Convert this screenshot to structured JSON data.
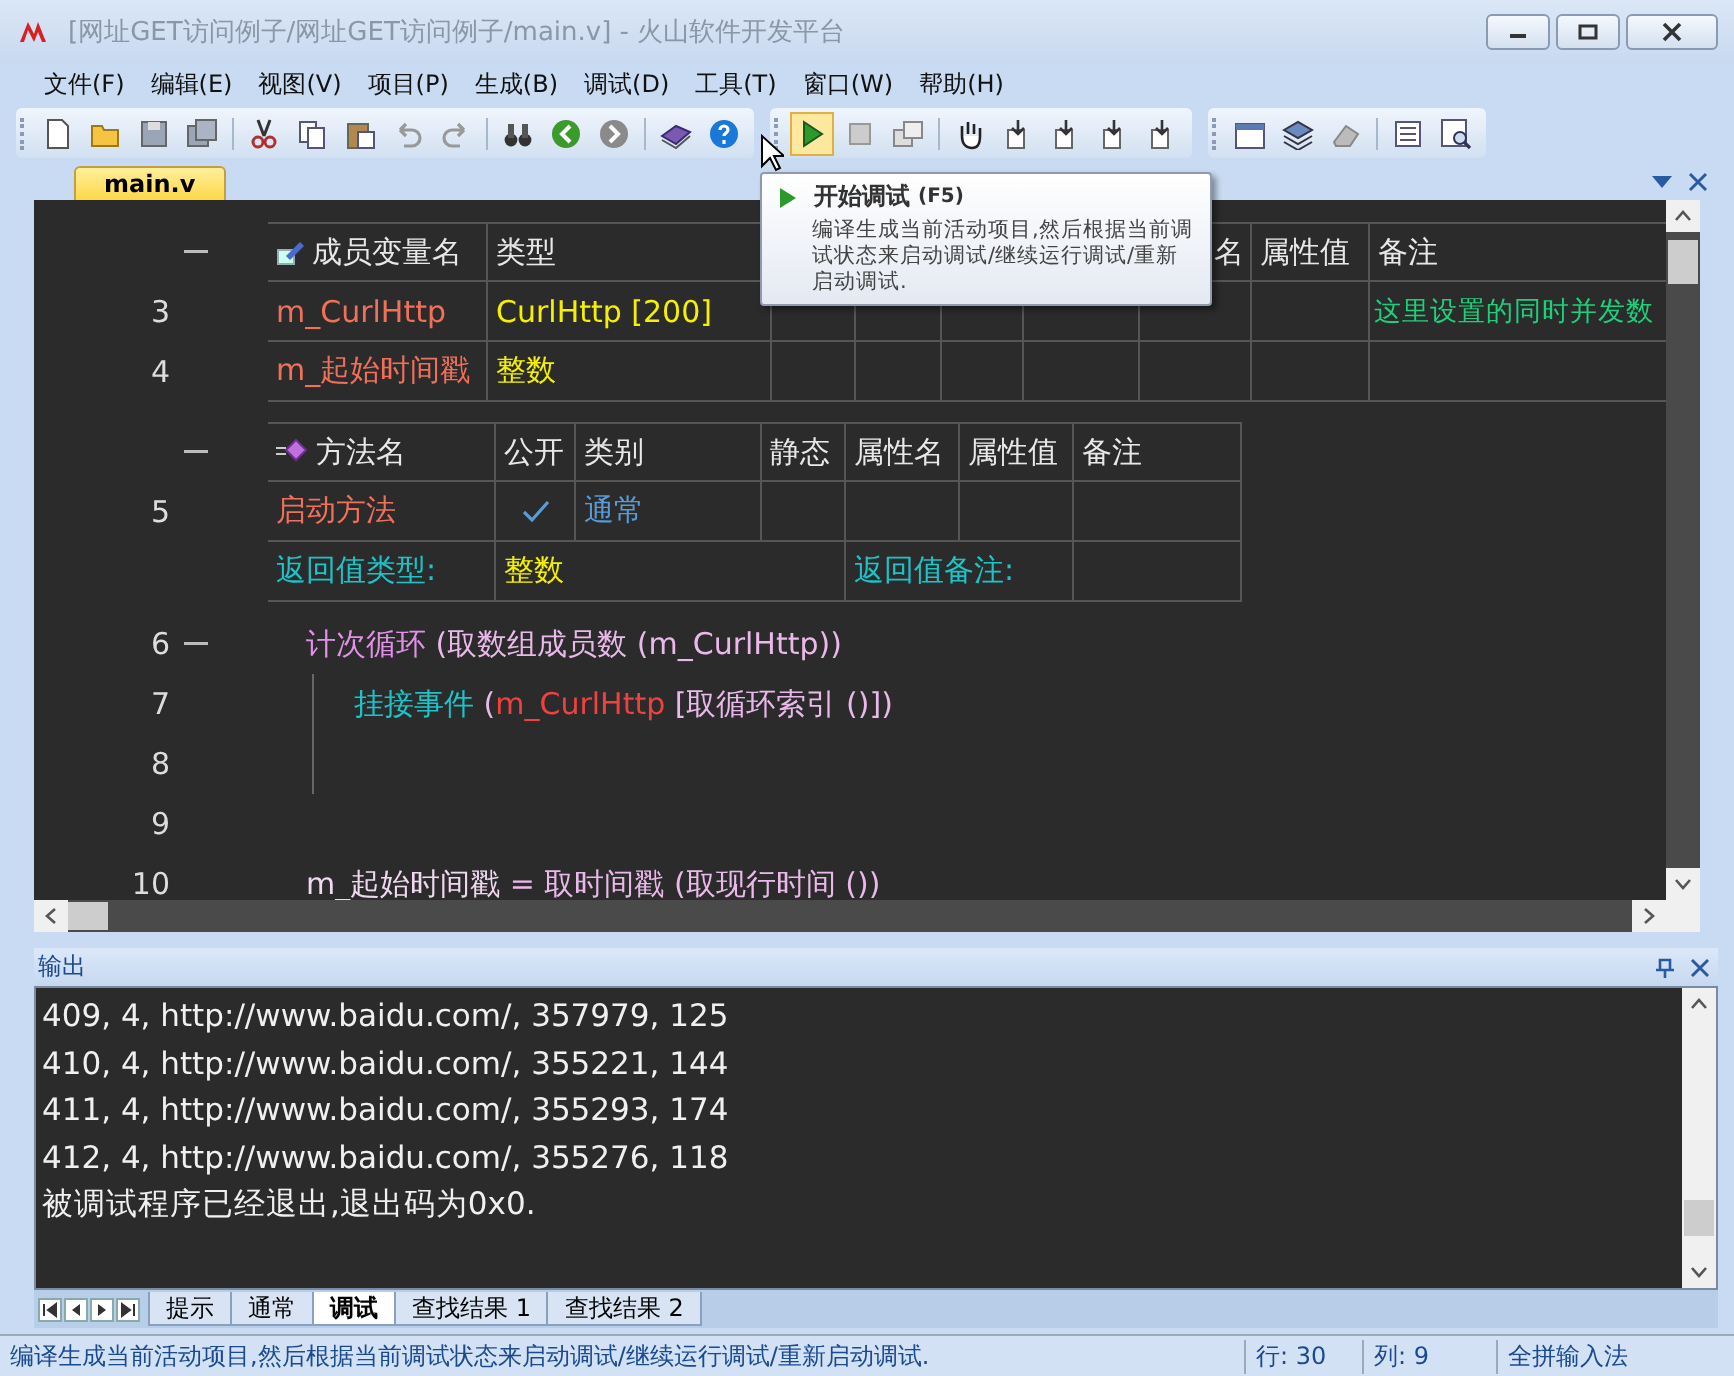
{
  "window": {
    "title": "[网址GET访问例子/网址GET访问例子/main.v] - 火山软件开发平台"
  },
  "menu": [
    "文件(F)",
    "编辑(E)",
    "视图(V)",
    "项目(P)",
    "生成(B)",
    "调试(D)",
    "工具(T)",
    "窗口(W)",
    "帮助(H)"
  ],
  "editor_tabs": [
    {
      "label": "main.v",
      "selected": true
    }
  ],
  "tooltip": {
    "title": "开始调试",
    "shortcut": "(F5)",
    "text": "编译生成当前活动项目,然后根据当前调试状态来启动调试/继续运行调试/重新启动调试."
  },
  "member_table": {
    "foldable": true,
    "header": {
      "column_1": "成员变量名",
      "column_2": "类型",
      "column_7": "名",
      "column_8": "属性值",
      "column_9": "备注"
    },
    "rows": [
      {
        "line": "3",
        "column_1": "m_CurlHttp",
        "column_2": "CurlHttp [200]",
        "column_9": "这里设置的同时并发数"
      },
      {
        "line": "4",
        "column_1": "m_起始时间戳",
        "column_2": "整数"
      }
    ]
  },
  "method_table": {
    "foldable": true,
    "header": {
      "column_1": "方法名",
      "column_2": "公开",
      "column_3": "类别",
      "column_4": "静态",
      "column_5": "属性名",
      "column_6": "属性值",
      "column_7": "备注"
    },
    "rows": [
      {
        "line": "5",
        "column_1": "启动方法",
        "public": true,
        "column_3": "通常"
      }
    ],
    "return_row": {
      "return_type_label": "返回值类型:",
      "return_type": "整数",
      "return_note_label": "返回值备注:"
    }
  },
  "code_lines": [
    {
      "line": "6",
      "foldable": true,
      "tokens": [
        {
          "kind": "keyword",
          "text": "计次循环"
        },
        {
          "kind": "expr",
          "text": " (取数组成员数 (m_CurlHttp))"
        }
      ],
      "children": [
        {
          "line": "7",
          "foldable": false,
          "tokens": [
            {
              "kind": "event",
              "text": "挂接事件"
            },
            {
              "kind": "expr",
              "text": " ("
            },
            {
              "kind": "member",
              "text": "m_CurlHttp"
            },
            {
              "kind": "expr",
              "text": " [取循环索引 ()])"
            }
          ]
        },
        {
          "line": "8",
          "foldable": false
        }
      ]
    },
    {
      "line": "9",
      "foldable": false
    },
    {
      "line": "10",
      "foldable": false,
      "tokens": [
        {
          "kind": "variable",
          "text": "m_起始时间戳"
        },
        {
          "kind": "expr",
          "text": " = 取时间戳 (取现行时间 ())"
        }
      ]
    }
  ],
  "output": {
    "title": "输出",
    "lines": [
      "409, 4, http://www.baidu.com/, 357979, 125",
      "410, 4, http://www.baidu.com/, 355221, 144",
      "411, 4, http://www.baidu.com/, 355293, 174",
      "412, 4, http://www.baidu.com/, 355276, 118",
      "被调试程序已经退出,退出码为0x0."
    ],
    "tabs": [
      {
        "label": "提示",
        "selected": false
      },
      {
        "label": "通常",
        "selected": false
      },
      {
        "label": "调试",
        "selected": true
      },
      {
        "label": "查找结果 1",
        "selected": false
      },
      {
        "label": "查找结果 2",
        "selected": false
      }
    ]
  },
  "status_bar": {
    "message": "编译生成当前活动项目,然后根据当前调试状态来启动调试/继续运行调试/重新启动调试.",
    "line": "行: 30",
    "column": "列: 9",
    "input_method": "全拼输入法"
  }
}
